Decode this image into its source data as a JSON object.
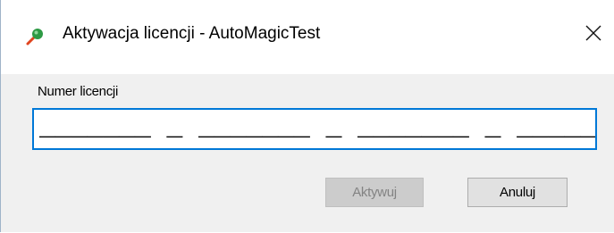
{
  "window": {
    "title": "Aktywacja licencji - AutoMagicTest",
    "app_icon": "automagictest-app-icon",
    "close_icon": "close-icon"
  },
  "license_field": {
    "label": "Numer licencji",
    "value": "_______ _ _______ _ _______ _ _______ _ _______"
  },
  "buttons": {
    "activate_label": "Aktywuj",
    "activate_enabled": false,
    "cancel_label": "Anuluj"
  },
  "colors": {
    "focus_border": "#0078d7",
    "client_background": "#f0f0f0",
    "disabled_text": "#838383"
  }
}
